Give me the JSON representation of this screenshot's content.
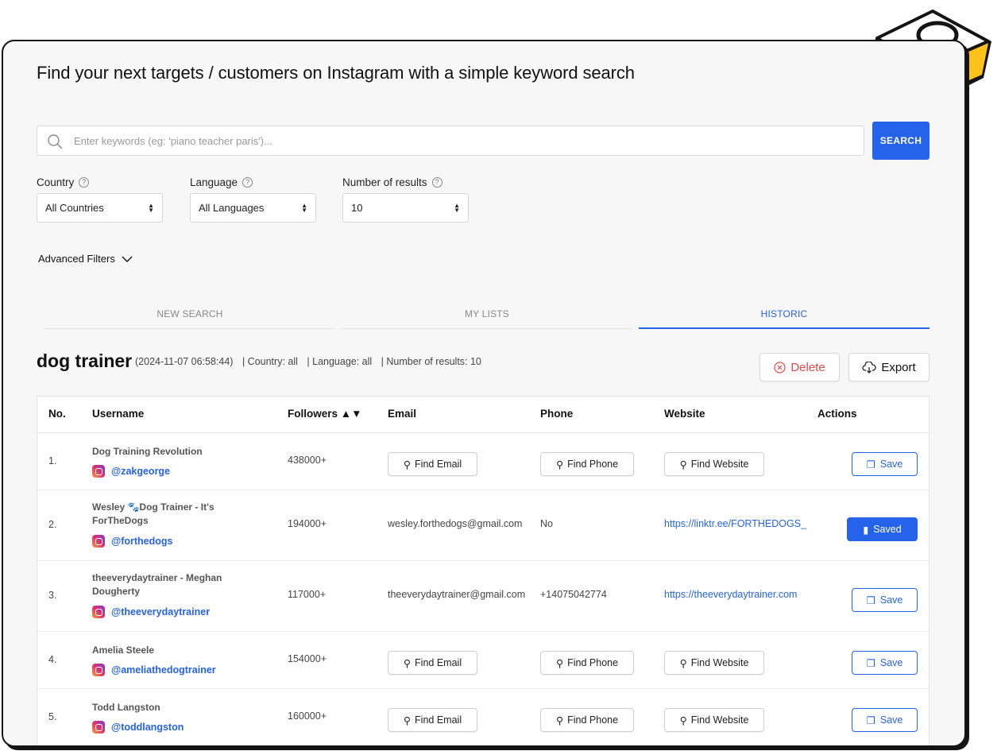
{
  "page": {
    "title": "Find your next targets / customers on Instagram with a simple keyword search"
  },
  "search": {
    "placeholder": "Enter keywords (eg: 'piano teacher paris')...",
    "button_label": "SEARCH"
  },
  "filters": {
    "country": {
      "label": "Country",
      "value": "All Countries"
    },
    "language": {
      "label": "Language",
      "value": "All Languages"
    },
    "results": {
      "label": "Number of results",
      "value": "10"
    },
    "advanced_label": "Advanced Filters"
  },
  "tabs": [
    {
      "label": "NEW SEARCH",
      "active": false
    },
    {
      "label": "MY LISTS",
      "active": false
    },
    {
      "label": "HISTORIC",
      "active": true
    }
  ],
  "history": {
    "keyword": "dog trainer",
    "timestamp": "(2024-11-07 06:58:44)",
    "country": "| Country: all",
    "language": "| Language: all",
    "results": "| Number of results: 10",
    "delete_label": "Delete",
    "export_label": "Export"
  },
  "table": {
    "headers": {
      "no": "No.",
      "username": "Username",
      "followers": "Followers ▲▼",
      "email": "Email",
      "phone": "Phone",
      "website": "Website",
      "actions": "Actions"
    },
    "buttons": {
      "find_email": "Find Email",
      "find_phone": "Find Phone",
      "find_website": "Find Website",
      "save": "Save",
      "saved": "Saved"
    },
    "rows": [
      {
        "no": "1.",
        "name": "Dog Training Revolution",
        "handle": "@zakgeorge",
        "followers": "438000+"
      },
      {
        "no": "2.",
        "name": "Wesley 🐾Dog Trainer - It's ForTheDogs",
        "handle": "@forthedogs",
        "followers": "194000+",
        "email": "wesley.forthedogs@gmail.com",
        "phone": "No",
        "website": "https://linktr.ee/FORTHEDOGS_"
      },
      {
        "no": "3.",
        "name": "theeverydaytrainer - Meghan Dougherty",
        "handle": "@theeverydaytrainer",
        "followers": "117000+",
        "email": "theeverydaytrainer@gmail.com",
        "phone": "+14075042774",
        "website": "https://theeverydaytrainer.com"
      },
      {
        "no": "4.",
        "name": "Amelia Steele",
        "handle": "@ameliathedogtrainer",
        "followers": "154000+"
      },
      {
        "no": "5.",
        "name": "Todd Langston",
        "handle": "@toddlangston",
        "followers": "160000+"
      }
    ]
  },
  "colors": {
    "accent": "#2563eb",
    "delete": "#e24b4b",
    "badge_yellow": "#ffc21a",
    "badge_orange": "#ff9f0a"
  }
}
